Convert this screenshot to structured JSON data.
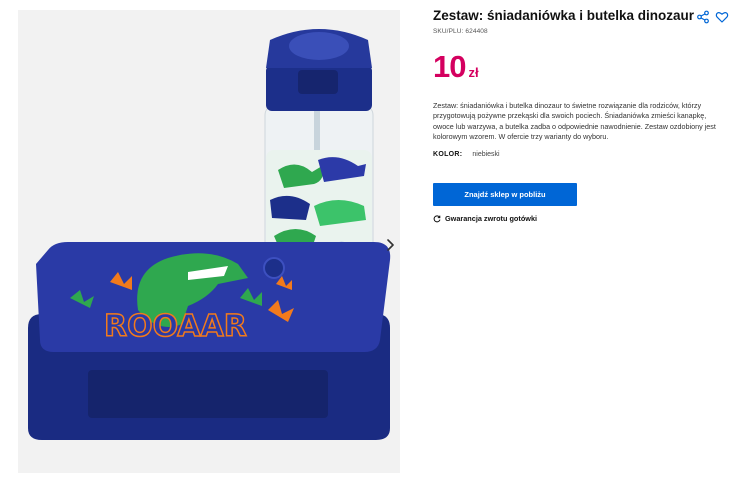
{
  "product": {
    "title": "Zestaw: śniadaniówka i butelka dinozaur",
    "sku_label": "SKU/PLU:",
    "sku_value": "624408",
    "price_amount": "10",
    "price_currency": "zł",
    "description": "Zestaw: śniadaniówka i butelka dinozaur to świetne rozwiązanie dla rodziców, którzy przygotowują pożywne przekąski dla swoich pociech. Śniadaniówka zmieści kanapkę, owoce lub warzywa, a butelka zadba o odpowiednie nawodnienie. Zestaw ozdobiony jest kolorowym wzorem. W ofercie trzy warianty do wyboru.",
    "color_label": "KOLOR:",
    "color_value": "niebieski"
  },
  "actions": {
    "find_store_label": "Znajdź sklep w pobliżu",
    "guarantee_label": "Gwarancja zwrotu gotówki"
  },
  "image": {
    "lunchbox_text": "ROOAAR"
  },
  "colors": {
    "accent_blue": "#0066d6",
    "price_pink": "#d4005f",
    "product_navy": "#1c2f8a",
    "dino_green": "#2fa84f"
  },
  "icons": {
    "share": "share-icon",
    "favorite": "heart-icon",
    "next": "chevron-right-icon",
    "guarantee": "refresh-icon"
  }
}
